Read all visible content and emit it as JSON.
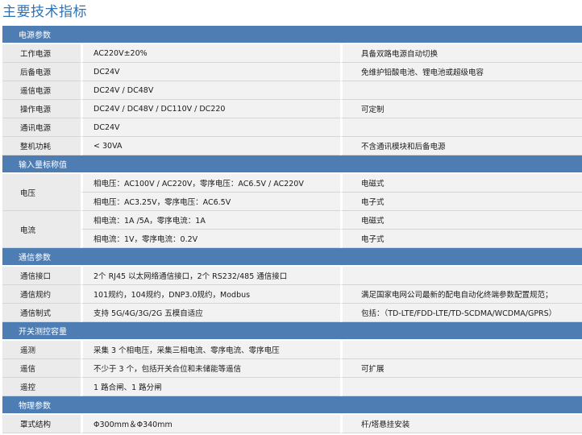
{
  "title": "主要技术指标",
  "sections": {
    "power": "电源参数",
    "input": "输入量标称值",
    "comm": "通信参数",
    "switch": "开关测控容量",
    "physical": "物理参数"
  },
  "rows": {
    "work_power": {
      "name": "工作电源",
      "value": "AC220V±20%",
      "note": "具备双路电源自动切换"
    },
    "backup_power": {
      "name": "后备电源",
      "value": "DC24V",
      "note": "免维护铅酸电池、锂电池或超级电容"
    },
    "telesignal_power": {
      "name": "遥信电源",
      "value": "DC24V / DC48V",
      "note": ""
    },
    "operate_power": {
      "name": "操作电源",
      "value": "DC24V / DC48V / DC110V / DC220",
      "note": "可定制"
    },
    "comm_power": {
      "name": "通讯电源",
      "value": "DC24V",
      "note": ""
    },
    "consumption": {
      "name": "整机功耗",
      "value": "< 30VA",
      "note": "不含通讯模块和后备电源"
    },
    "voltage": {
      "name": "电压",
      "value1": "相电压：AC100V / AC220V，零序电压：AC6.5V / AC220V",
      "note1": "电磁式",
      "value2": "相电压：AC3.25V，零序电压：AC6.5V",
      "note2": "电子式"
    },
    "current": {
      "name": "电流",
      "value1": "相电流：1A /5A，零序电流：1A",
      "note1": "电磁式",
      "value2": "相电流：1V，零序电流：0.2V",
      "note2": "电子式"
    },
    "comm_port": {
      "name": "通信接口",
      "value": "2个 RJ45 以太网络通信接口，2个 RS232/485 通信接口",
      "note": ""
    },
    "protocol": {
      "name": "通信规约",
      "value": "101规约，104规约，DNP3.0规约，Modbus",
      "note": "满足国家电网公司最新的配电自动化终端参数配置规范；"
    },
    "standard": {
      "name": "通信制式",
      "value": "支持 5G/4G/3G/2G 五模自适应",
      "note": "包括：（TD-LTE/FDD-LTE/TD-SCDMA/WCDMA/GPRS）"
    },
    "telemetry": {
      "name": "遥测",
      "value": "采集 3 个相电压，采集三相电流、零序电流、零序电压",
      "note": ""
    },
    "telesignal": {
      "name": "遥信",
      "value": "不少于 3 个，包括开关合位和未储能等遥信",
      "note": "可扩展"
    },
    "telecontrol": {
      "name": "遥控",
      "value": "1 路合闸、1 路分闸",
      "note": ""
    },
    "structure": {
      "name": "罩式结构",
      "value": "Φ300mm＆Φ340mm",
      "note": "杆/塔悬挂安装"
    }
  }
}
